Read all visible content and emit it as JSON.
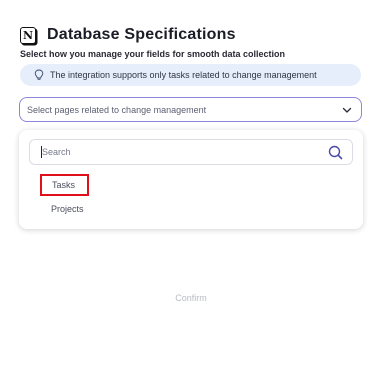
{
  "header": {
    "logo_letter": "N",
    "title": "Database Specifications"
  },
  "subtitle": "Select how you manage your fields for smooth data collection",
  "info_banner": {
    "icon": "lightbulb-icon",
    "text": "The integration supports only tasks related to change management"
  },
  "select": {
    "placeholder": "Select pages related to change management",
    "icon": "chevron-down-icon"
  },
  "dropdown": {
    "search_placeholder": "Search",
    "search_icon": "search-icon",
    "options": [
      {
        "label": "Tasks",
        "highlighted": true
      },
      {
        "label": "Projects",
        "highlighted": false
      }
    ]
  },
  "confirm_label": "Confirm",
  "colors": {
    "accent_border": "#8e86d8",
    "banner_bg": "#e6eefb",
    "highlight": "#e0101a",
    "disabled_text": "#b9bcc6"
  }
}
